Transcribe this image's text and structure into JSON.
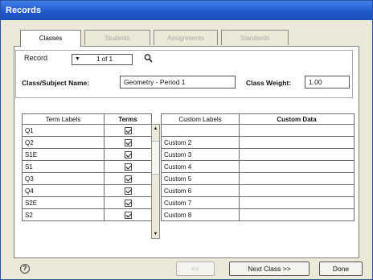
{
  "window": {
    "title": "Records"
  },
  "tabs": [
    {
      "label": "Classes",
      "active": true
    },
    {
      "label": "Students",
      "active": false
    },
    {
      "label": "Assignments",
      "active": false
    },
    {
      "label": "Standards",
      "active": false
    }
  ],
  "record": {
    "label": "Record",
    "nav_value": "1 of 1",
    "class_name_label": "Class/Subject Name:",
    "class_name_value": "Geometry - Period 1",
    "class_weight_label": "Class Weight:",
    "class_weight_value": "1.00"
  },
  "terms_table": {
    "headers": [
      "Term Labels",
      "Terms"
    ],
    "rows": [
      {
        "label": "Q1",
        "checked": true
      },
      {
        "label": "Q2",
        "checked": true
      },
      {
        "label": "S1E",
        "checked": true
      },
      {
        "label": "S1",
        "checked": true
      },
      {
        "label": "Q3",
        "checked": true
      },
      {
        "label": "Q4",
        "checked": true
      },
      {
        "label": "S2E",
        "checked": true
      },
      {
        "label": "S2",
        "checked": true
      }
    ]
  },
  "custom_table": {
    "headers": [
      "Custom Labels",
      "Custom Data"
    ],
    "rows": [
      {
        "label": "",
        "data": ""
      },
      {
        "label": "Custom 2",
        "data": ""
      },
      {
        "label": "Custom 3",
        "data": ""
      },
      {
        "label": "Custom 4",
        "data": ""
      },
      {
        "label": "Custom 5",
        "data": ""
      },
      {
        "label": "Custom 6",
        "data": ""
      },
      {
        "label": "Custom 7",
        "data": ""
      },
      {
        "label": "Custom 8",
        "data": ""
      }
    ]
  },
  "footer": {
    "help_glyph": "?",
    "prev_label": "<<",
    "next_label": "Next Class >>",
    "done_label": "Done"
  }
}
